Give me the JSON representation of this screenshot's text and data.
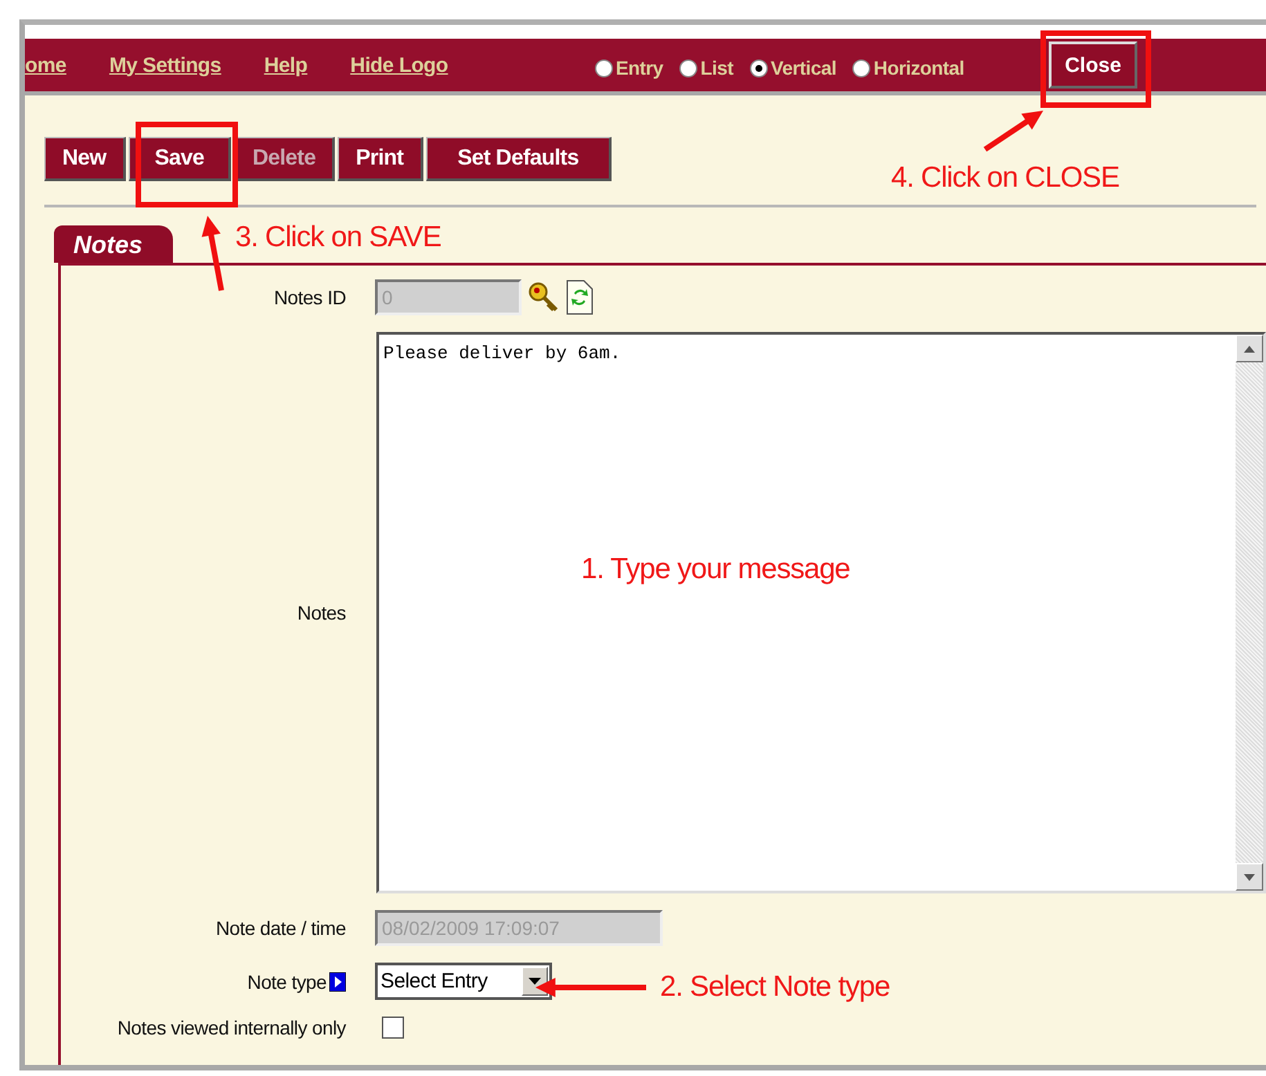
{
  "nav": {
    "links": [
      "ome",
      "My Settings",
      "Help",
      "Hide Logo"
    ],
    "view_options": [
      {
        "label": "Entry",
        "selected": false
      },
      {
        "label": "List",
        "selected": false
      },
      {
        "label": "Vertical",
        "selected": true
      },
      {
        "label": "Horizontal",
        "selected": false
      }
    ],
    "close_button": "Close"
  },
  "toolbar": [
    {
      "label": "New",
      "disabled": false
    },
    {
      "label": "Save",
      "disabled": false
    },
    {
      "label": "Delete",
      "disabled": true
    },
    {
      "label": "Print",
      "disabled": false
    },
    {
      "label": "Set Defaults",
      "disabled": false
    }
  ],
  "tabs": [
    {
      "label": "Notes",
      "selected": true
    }
  ],
  "form": {
    "notes_id": {
      "label": "Notes ID",
      "value": "0"
    },
    "notes": {
      "label": "Notes",
      "value": "Please deliver by 6am."
    },
    "note_datetime": {
      "label": "Note date / time",
      "value": "08/02/2009 17:09:07"
    },
    "note_type": {
      "label": "Note type",
      "value": "Select Entry"
    },
    "internal_only": {
      "label": "Notes viewed internally only",
      "checked": false
    }
  },
  "annotations": [
    {
      "text": "1. Type your message"
    },
    {
      "text": "2. Select Note type"
    },
    {
      "text": "3. Click on SAVE"
    },
    {
      "text": "4. Click on CLOSE"
    }
  ]
}
